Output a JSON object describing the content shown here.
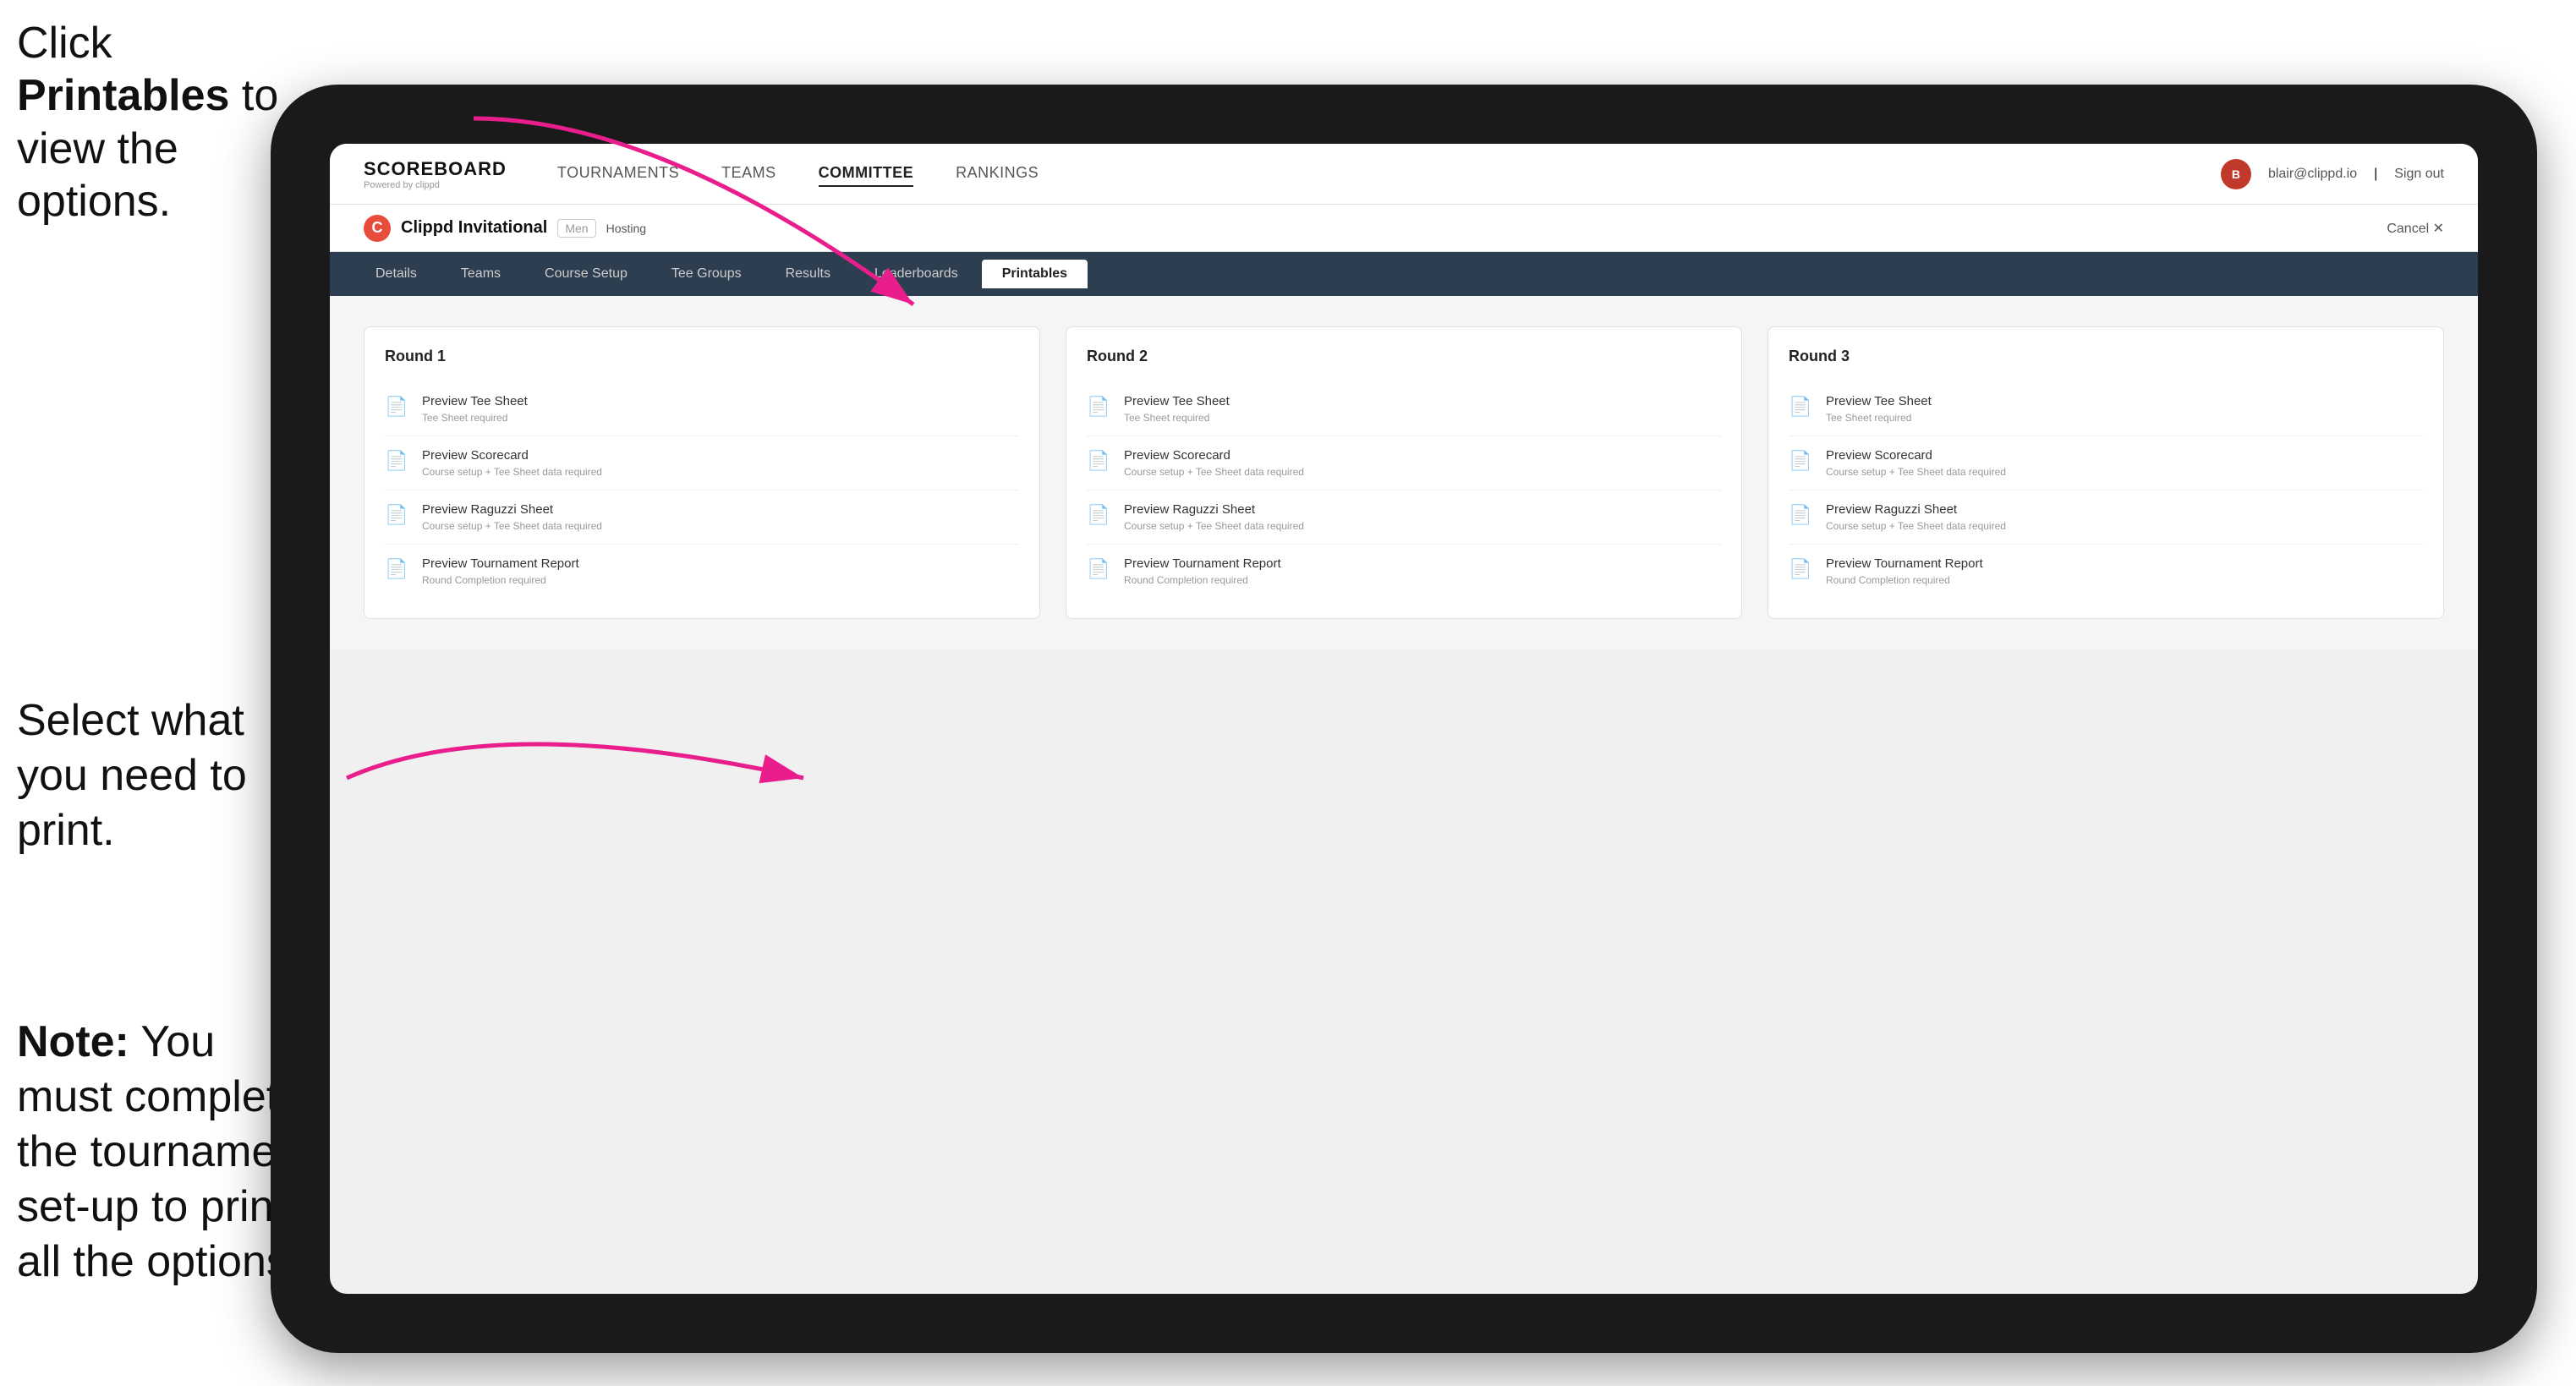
{
  "instructions": {
    "top": "Click ",
    "top_bold": "Printables",
    "top_rest": " to view the options.",
    "middle": "Select what you need to print.",
    "bottom_bold": "Note:",
    "bottom_rest": " You must complete the tournament set-up to print all the options."
  },
  "nav": {
    "logo_title": "SCOREBOARD",
    "logo_sub": "Powered by clippd",
    "items": [
      "TOURNAMENTS",
      "TEAMS",
      "COMMITTEE",
      "RANKINGS"
    ],
    "user_email": "blair@clippd.io",
    "sign_out": "Sign out",
    "separator": "|"
  },
  "tournament": {
    "name": "Clippd Invitational",
    "badge": "Men",
    "hosting": "Hosting",
    "cancel": "Cancel"
  },
  "tabs": {
    "items": [
      "Details",
      "Teams",
      "Course Setup",
      "Tee Groups",
      "Results",
      "Leaderboards",
      "Printables"
    ],
    "active": "Printables"
  },
  "rounds": [
    {
      "title": "Round 1",
      "items": [
        {
          "label": "Preview Tee Sheet",
          "sub": "Tee Sheet required"
        },
        {
          "label": "Preview Scorecard",
          "sub": "Course setup + Tee Sheet data required"
        },
        {
          "label": "Preview Raguzzi Sheet",
          "sub": "Course setup + Tee Sheet data required"
        },
        {
          "label": "Preview Tournament Report",
          "sub": "Round Completion required"
        }
      ]
    },
    {
      "title": "Round 2",
      "items": [
        {
          "label": "Preview Tee Sheet",
          "sub": "Tee Sheet required"
        },
        {
          "label": "Preview Scorecard",
          "sub": "Course setup + Tee Sheet data required"
        },
        {
          "label": "Preview Raguzzi Sheet",
          "sub": "Course setup + Tee Sheet data required"
        },
        {
          "label": "Preview Tournament Report",
          "sub": "Round Completion required"
        }
      ]
    },
    {
      "title": "Round 3",
      "items": [
        {
          "label": "Preview Tee Sheet",
          "sub": "Tee Sheet required"
        },
        {
          "label": "Preview Scorecard",
          "sub": "Course setup + Tee Sheet data required"
        },
        {
          "label": "Preview Raguzzi Sheet",
          "sub": "Course setup + Tee Sheet data required"
        },
        {
          "label": "Preview Tournament Report",
          "sub": "Round Completion required"
        }
      ]
    }
  ],
  "colors": {
    "accent": "#e74c3c",
    "nav_bg": "#2c3e50",
    "arrow_color": "#e91e8c"
  }
}
